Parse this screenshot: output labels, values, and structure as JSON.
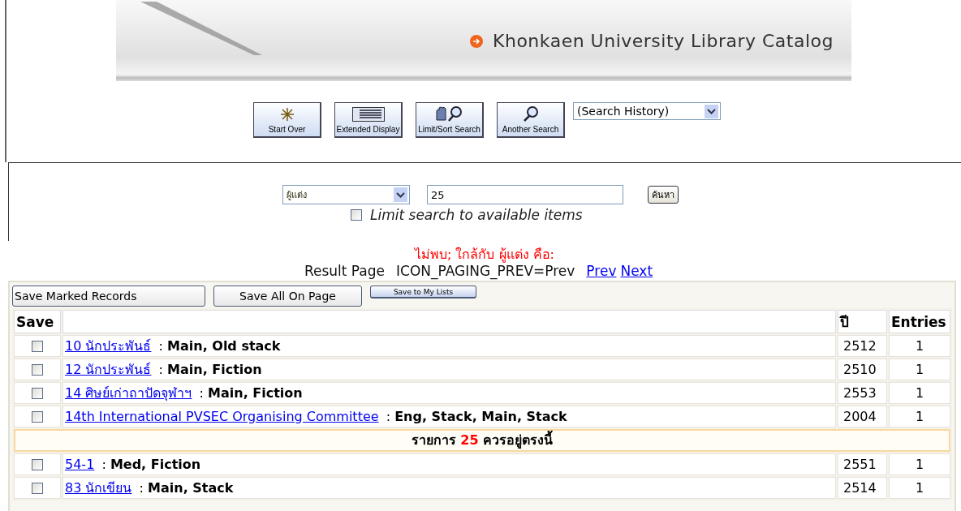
{
  "banner": {
    "title": "Khonkaen University Library Catalog"
  },
  "toolbar": {
    "buttons": [
      {
        "kind": "start",
        "label": "Start Over"
      },
      {
        "kind": "display",
        "label": "Extended Display"
      },
      {
        "kind": "limit",
        "label": "Limit/Sort Search"
      },
      {
        "kind": "search",
        "label": "Another Search"
      }
    ],
    "history": {
      "value": "(Search History)"
    }
  },
  "search": {
    "field": {
      "value": "ผู้แต่ง"
    },
    "query": {
      "value": "25"
    },
    "submit": "ค้นหา",
    "limit": {
      "label": "Limit search to available items",
      "checked": false
    }
  },
  "notice": "ไม่พบ; ใกล้กับ ผู้แต่ง คือ:",
  "paging": {
    "label": "Result Page",
    "prev_text": "ICON_PAGING_PREV=Prev",
    "links": [
      "Prev",
      "Next"
    ]
  },
  "actions": [
    "Save Marked Records",
    "Save All On Page",
    "Save to My Lists"
  ],
  "table": {
    "columns": [
      "Save",
      "ปี",
      "Entries"
    ],
    "rows": [
      {
        "kind": "entry",
        "checked": false,
        "link": "10 นักประพันธ์",
        "location": ": **Main, Old stack**",
        "year": "2512",
        "entries": "1"
      },
      {
        "kind": "entry",
        "checked": false,
        "link": "12 นักประพันธ์",
        "location": ": **Main, Fiction**",
        "year": "2510",
        "entries": "1"
      },
      {
        "kind": "entry",
        "checked": false,
        "link": "14 ศิษย์เก่าถาปัดจุฬาฯ",
        "location": ": **Main, Fiction**",
        "year": "2553",
        "entries": "1"
      },
      {
        "kind": "entry",
        "checked": false,
        "link": "14th International PVSEC Organising Committee",
        "location": ": **Eng, Stack, Main, Stack**",
        "year": "2004",
        "entries": "1"
      },
      {
        "kind": "marker",
        "before": "รายการ",
        "term": "25",
        "after": "ควรอยู่ตรงนี้"
      },
      {
        "kind": "entry",
        "checked": false,
        "link": "54-1",
        "location": ": **Med, Fiction**",
        "year": "2551",
        "entries": "1"
      },
      {
        "kind": "entry",
        "checked": false,
        "link": "83 นักเขียน",
        "location": ": **Main, Stack**",
        "year": "2514",
        "entries": "1"
      }
    ]
  }
}
